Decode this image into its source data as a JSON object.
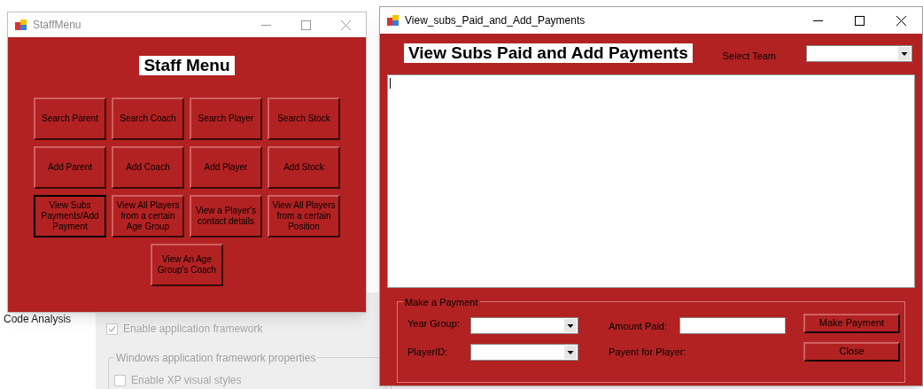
{
  "background": {
    "sidebar_item": "Code Analysis",
    "checkboxes": [
      {
        "label": "Enable application framework",
        "checked": true
      }
    ],
    "group": {
      "title": "Windows application framework properties",
      "checkboxes": [
        {
          "label": "Enable XP visual styles",
          "checked": false
        }
      ]
    }
  },
  "staff_window": {
    "title": "StaffMenu",
    "active": false,
    "heading": "Staff Menu",
    "buttons": [
      {
        "label": "Search Parent",
        "focused": false
      },
      {
        "label": "Search Coach",
        "focused": false
      },
      {
        "label": "Search Player",
        "focused": false
      },
      {
        "label": "Search Stock",
        "focused": false
      },
      {
        "label": "Add Parent",
        "focused": false
      },
      {
        "label": "Add Coach",
        "focused": false
      },
      {
        "label": "Add Player",
        "focused": false
      },
      {
        "label": "Add Stock",
        "focused": false
      },
      {
        "label": "View Subs Payments/Add Payment",
        "focused": true
      },
      {
        "label": "View All Players from a certain Age Group",
        "focused": false
      },
      {
        "label": "View a Player's contact details",
        "focused": false
      },
      {
        "label": "View All Players from a certain Position",
        "focused": false
      },
      {
        "label": "View An Age Group's Coach",
        "focused": false
      }
    ]
  },
  "payments_window": {
    "title": "View_subs_Paid_and_Add_Payments",
    "active": true,
    "heading": "View Subs Paid and Add Payments",
    "select_team_label": "Select Team",
    "payment_group": {
      "title": "Make a Payment",
      "year_group_label": "Year Group:",
      "player_id_label": "PlayerID:",
      "amount_paid_label": "Amount Paid:",
      "payment_for_label": "Payent for Player:",
      "buttons": [
        {
          "label": "Make Payment"
        },
        {
          "label": "Close"
        }
      ]
    }
  }
}
